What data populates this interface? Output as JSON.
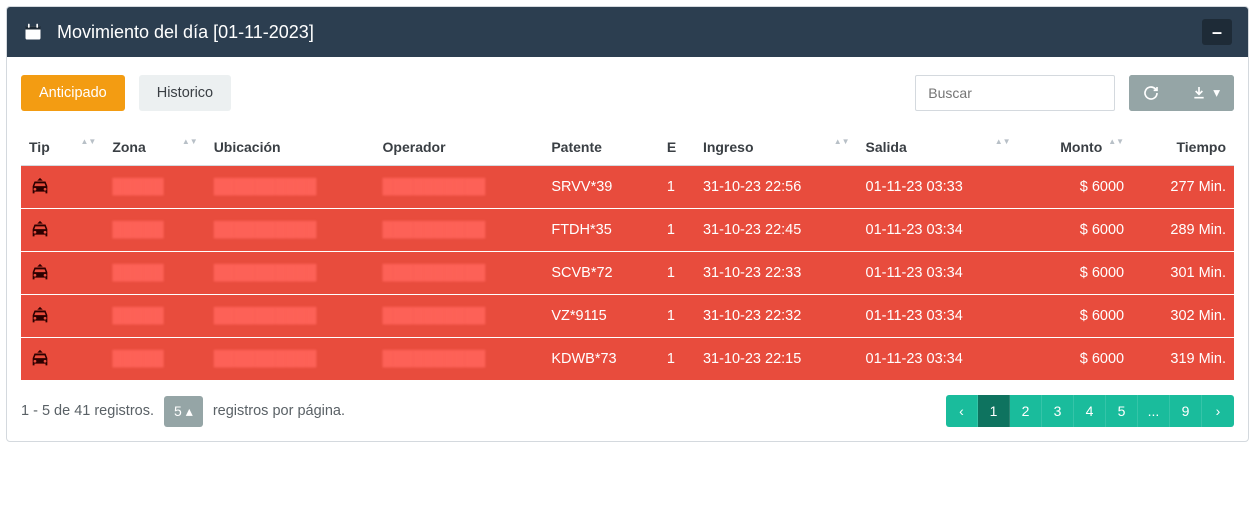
{
  "header": {
    "title": "Movimiento del día  [01-11-2023]"
  },
  "toolbar": {
    "anticipado_label": "Anticipado",
    "historico_label": "Historico",
    "search_placeholder": "Buscar"
  },
  "columns": {
    "tip": "Tip",
    "zona": "Zona",
    "ubicacion": "Ubicación",
    "operador": "Operador",
    "patente": "Patente",
    "e": "E",
    "ingreso": "Ingreso",
    "salida": "Salida",
    "monto": "Monto",
    "tiempo": "Tiempo"
  },
  "rows": [
    {
      "zona": "",
      "ubicacion": "",
      "operador": "",
      "patente": "SRVV*39",
      "e": "1",
      "ingreso": "31-10-23 22:56",
      "salida": "01-11-23 03:33",
      "monto": "$ 6000",
      "tiempo": "277 Min."
    },
    {
      "zona": "",
      "ubicacion": "",
      "operador": "",
      "patente": "FTDH*35",
      "e": "1",
      "ingreso": "31-10-23 22:45",
      "salida": "01-11-23 03:34",
      "monto": "$ 6000",
      "tiempo": "289 Min."
    },
    {
      "zona": "",
      "ubicacion": "",
      "operador": "",
      "patente": "SCVB*72",
      "e": "1",
      "ingreso": "31-10-23 22:33",
      "salida": "01-11-23 03:34",
      "monto": "$ 6000",
      "tiempo": "301 Min."
    },
    {
      "zona": "",
      "ubicacion": "",
      "operador": "",
      "patente": "VZ*9115",
      "e": "1",
      "ingreso": "31-10-23 22:32",
      "salida": "01-11-23 03:34",
      "monto": "$ 6000",
      "tiempo": "302 Min."
    },
    {
      "zona": "",
      "ubicacion": "",
      "operador": "",
      "patente": "KDWB*73",
      "e": "1",
      "ingreso": "31-10-23 22:15",
      "salida": "01-11-23 03:34",
      "monto": "$ 6000",
      "tiempo": "319 Min."
    }
  ],
  "footer": {
    "range_text": "1 - 5 de 41 registros.",
    "page_size": "5",
    "per_page_label": "registros por página."
  },
  "pagination": {
    "prev": "‹",
    "pages": [
      "1",
      "2",
      "3",
      "4",
      "5",
      "...",
      "9"
    ],
    "active": "1",
    "next": "›"
  }
}
